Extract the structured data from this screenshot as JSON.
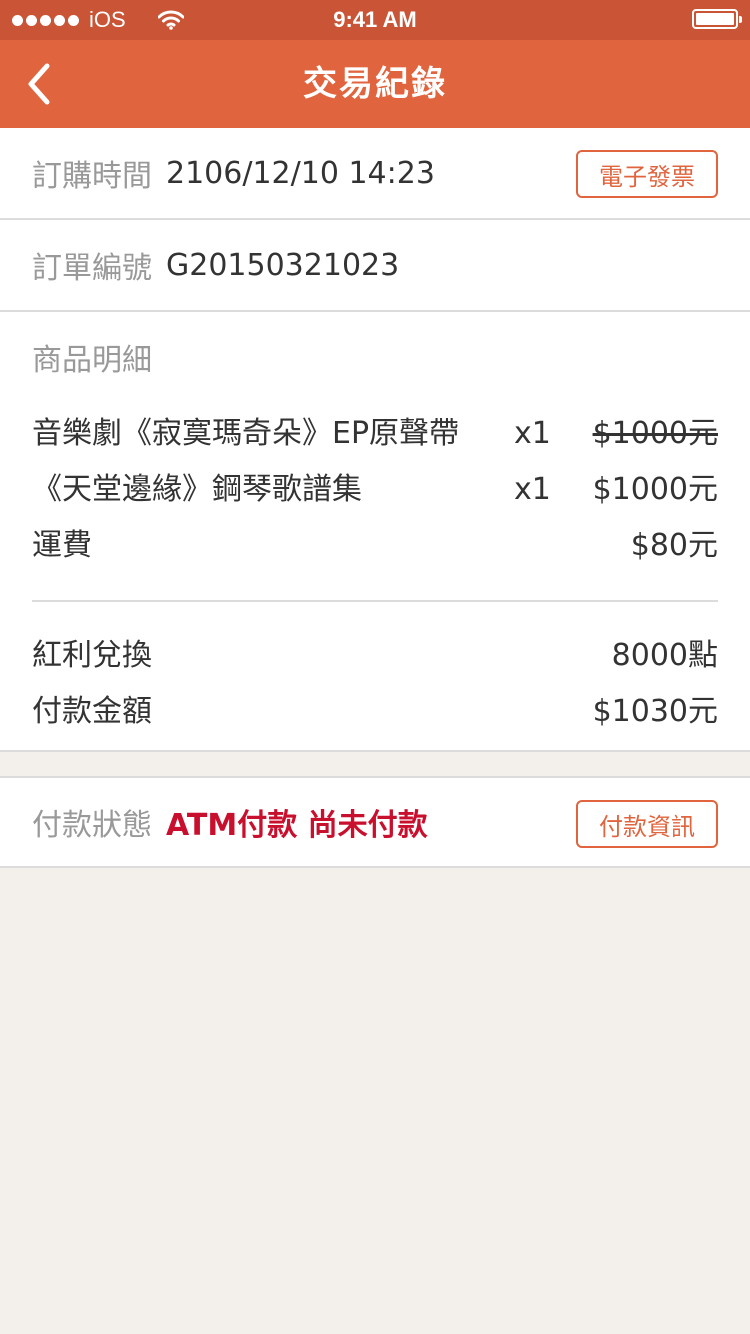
{
  "status_bar": {
    "carrier": "iOS",
    "time": "9:41 AM"
  },
  "nav": {
    "title": "交易紀錄",
    "back_icon": "chevron-left-icon"
  },
  "order_time": {
    "label": "訂購時間",
    "value": "2106/12/10 14:23",
    "button_label": "電子發票"
  },
  "order_number": {
    "label": "訂單編號",
    "value": "G20150321023"
  },
  "details": {
    "title": "商品明細",
    "items": [
      {
        "name": "音樂劇《寂寞瑪奇朵》EP原聲帶",
        "qty": "x1",
        "price": "$1000元",
        "struck": true
      },
      {
        "name": "《天堂邊緣》鋼琴歌譜集",
        "qty": "x1",
        "price": "$1000元",
        "struck": false
      },
      {
        "name": "運費",
        "qty": "",
        "price": "$80元",
        "struck": false
      }
    ],
    "summary": [
      {
        "label": "紅利兌換",
        "value": "8000點"
      },
      {
        "label": "付款金額",
        "value": "$1030元"
      }
    ]
  },
  "payment_status": {
    "label": "付款狀態",
    "value": "ATM付款 尚未付款",
    "button_label": "付款資訊"
  },
  "colors": {
    "nav": "#e0643d",
    "status_bar": "#c95536",
    "accent": "#e0643d",
    "alert": "#c8102e",
    "background": "#f3f0ec"
  }
}
